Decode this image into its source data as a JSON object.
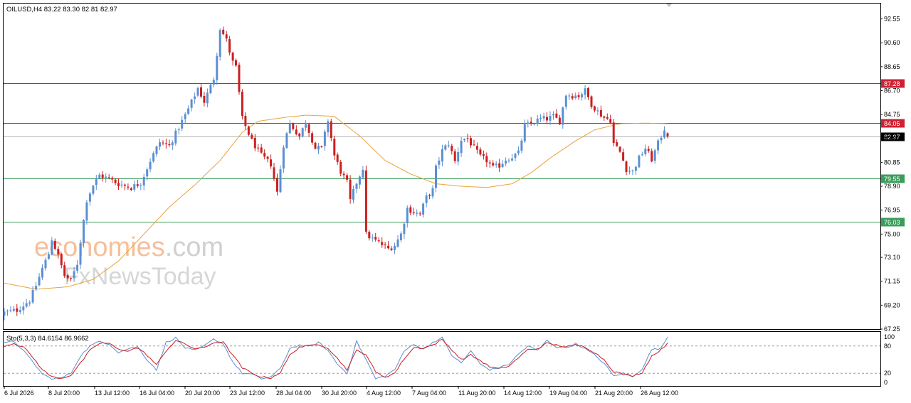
{
  "header": {
    "symbol_text": "OILUSD,H4  83.22 83.30 82.81 82.97"
  },
  "watermark": {
    "brand_colored": "economies",
    "brand_suffix": ".com",
    "sub_brand": "FxNewsToday",
    "brand_color": "#f5b48a",
    "suffix_color": "#c8c8c8",
    "sub_color": "#cfcfcf"
  },
  "colors": {
    "bull": "#5b8fd4",
    "bear": "#cc1f1f",
    "ma": "#e8a33c",
    "resistance": "#cc2233",
    "support": "#3a9e5a",
    "price_line": "#b5b5b5",
    "stoch_main": "#5b8fd4",
    "stoch_signal": "#cc1f1f"
  },
  "chart_data": [
    {
      "type": "candlestick",
      "symbol": "OILUSD",
      "timeframe": "H4",
      "ohlc_last": {
        "open": 83.22,
        "high": 83.3,
        "low": 82.81,
        "close": 82.97
      },
      "ylim": [
        67.25,
        93.8
      ],
      "y_ticks": [
        "92.55",
        "90.60",
        "88.65",
        "86.70",
        "84.75",
        "82.80",
        "80.85",
        "78.90",
        "76.95",
        "75.00",
        "73.10",
        "71.15",
        "69.20",
        "67.25"
      ],
      "x_ticks": [
        "6 Jul 2026",
        "8 Jul 20:00",
        "13 Jul 12:00",
        "16 Jul 04:00",
        "20 Jul 20:00",
        "23 Jul 12:00",
        "28 Jul 04:00",
        "30 Jul 20:00",
        "4 Aug 12:00",
        "7 Aug 04:00",
        "11 Aug 20:00",
        "14 Aug 12:00",
        "19 Aug 04:00",
        "21 Aug 20:00",
        "26 Aug 12:00"
      ],
      "levels": [
        {
          "value": 87.28,
          "label": "87.28",
          "kind": "resistance"
        },
        {
          "value": 84.05,
          "label": "84.05",
          "kind": "resistance"
        },
        {
          "value": 79.55,
          "label": "79.55",
          "kind": "support"
        },
        {
          "value": 76.03,
          "label": "76.03",
          "kind": "support"
        }
      ],
      "current_price": {
        "value": 82.97,
        "label": "82.97"
      },
      "close_path": [
        [
          0,
          68.6
        ],
        [
          4,
          68.8
        ],
        [
          8,
          69.6
        ],
        [
          10,
          70.8
        ],
        [
          12,
          72.2
        ],
        [
          14,
          73.4
        ],
        [
          15,
          74.6
        ],
        [
          17,
          73.2
        ],
        [
          19,
          71.6
        ],
        [
          21,
          71.2
        ],
        [
          23,
          72.6
        ],
        [
          24,
          74.4
        ],
        [
          26,
          77.8
        ],
        [
          28,
          79.0
        ],
        [
          30,
          79.8
        ],
        [
          33,
          79.5
        ],
        [
          36,
          79.1
        ],
        [
          40,
          78.8
        ],
        [
          43,
          79.2
        ],
        [
          46,
          81.0
        ],
        [
          49,
          82.5
        ],
        [
          52,
          82.2
        ],
        [
          55,
          83.7
        ],
        [
          58,
          85.2
        ],
        [
          61,
          86.9
        ],
        [
          63,
          85.8
        ],
        [
          66,
          87.7
        ],
        [
          68,
          91.8
        ],
        [
          70,
          90.8
        ],
        [
          72,
          89.0
        ],
        [
          73,
          88.6
        ],
        [
          75,
          84.4
        ],
        [
          78,
          82.6
        ],
        [
          81,
          81.4
        ],
        [
          84,
          80.7
        ],
        [
          86,
          78.4
        ],
        [
          88,
          82.3
        ],
        [
          90,
          84.0
        ],
        [
          93,
          83.0
        ],
        [
          95,
          84.1
        ],
        [
          98,
          82.0
        ],
        [
          100,
          82.0
        ],
        [
          102,
          84.3
        ],
        [
          104,
          81.4
        ],
        [
          106,
          80.1
        ],
        [
          108,
          79.2
        ],
        [
          109,
          77.7
        ],
        [
          111,
          79.2
        ],
        [
          113,
          80.4
        ],
        [
          114,
          75.0
        ],
        [
          116,
          74.6
        ],
        [
          118,
          74.3
        ],
        [
          121,
          73.8
        ],
        [
          123,
          74.1
        ],
        [
          125,
          75.0
        ],
        [
          127,
          77.1
        ],
        [
          129,
          76.8
        ],
        [
          131,
          76.6
        ],
        [
          133,
          78.0
        ],
        [
          135,
          78.6
        ],
        [
          136,
          80.4
        ],
        [
          138,
          81.8
        ],
        [
          140,
          82.4
        ],
        [
          142,
          80.9
        ],
        [
          144,
          82.7
        ],
        [
          146,
          82.8
        ],
        [
          148,
          82.0
        ],
        [
          150,
          81.3
        ],
        [
          152,
          81.0
        ],
        [
          154,
          80.4
        ],
        [
          156,
          80.6
        ],
        [
          158,
          81.1
        ],
        [
          160,
          81.3
        ],
        [
          162,
          81.6
        ],
        [
          164,
          83.8
        ],
        [
          166,
          84.0
        ],
        [
          169,
          84.4
        ],
        [
          171,
          84.4
        ],
        [
          173,
          84.6
        ],
        [
          175,
          84.2
        ],
        [
          177,
          86.4
        ],
        [
          179,
          86.3
        ],
        [
          181,
          86.3
        ],
        [
          183,
          86.7
        ],
        [
          185,
          85.6
        ],
        [
          187,
          85.0
        ],
        [
          189,
          84.5
        ],
        [
          191,
          84.3
        ],
        [
          192,
          82.4
        ],
        [
          194,
          81.7
        ],
        [
          196,
          80.3
        ],
        [
          198,
          80.1
        ],
        [
          200,
          81.2
        ],
        [
          202,
          82.0
        ],
        [
          204,
          81.1
        ],
        [
          206,
          82.4
        ],
        [
          208,
          83.6
        ],
        [
          209,
          82.97
        ]
      ],
      "moving_average_path": [
        [
          0,
          71.0
        ],
        [
          10,
          70.5
        ],
        [
          20,
          70.7
        ],
        [
          28,
          71.3
        ],
        [
          36,
          72.8
        ],
        [
          44,
          75.0
        ],
        [
          52,
          77.2
        ],
        [
          60,
          79.0
        ],
        [
          68,
          81.0
        ],
        [
          75,
          83.3
        ],
        [
          80,
          84.2
        ],
        [
          88,
          84.5
        ],
        [
          95,
          84.7
        ],
        [
          104,
          84.6
        ],
        [
          112,
          83.0
        ],
        [
          120,
          81.0
        ],
        [
          128,
          79.9
        ],
        [
          136,
          79.1
        ],
        [
          144,
          78.9
        ],
        [
          152,
          78.8
        ],
        [
          160,
          79.1
        ],
        [
          166,
          80.0
        ],
        [
          172,
          81.2
        ],
        [
          180,
          82.6
        ],
        [
          186,
          83.5
        ],
        [
          194,
          84.0
        ],
        [
          202,
          84.05
        ],
        [
          209,
          84.0
        ]
      ],
      "bar_count": 210
    },
    {
      "type": "line",
      "indicator": "Stochastic",
      "label": "Sto(5,3,3) 84.6154 86.9662",
      "ylim": [
        0,
        100
      ],
      "y_ticks": [
        "100",
        "80",
        "20",
        "0"
      ],
      "levels": [
        80,
        20
      ],
      "main_path": [
        [
          0,
          86
        ],
        [
          3,
          91
        ],
        [
          6,
          70
        ],
        [
          9,
          45
        ],
        [
          12,
          18
        ],
        [
          15,
          8
        ],
        [
          18,
          10
        ],
        [
          21,
          20
        ],
        [
          24,
          58
        ],
        [
          27,
          80
        ],
        [
          30,
          90
        ],
        [
          33,
          85
        ],
        [
          36,
          66
        ],
        [
          39,
          74
        ],
        [
          42,
          78
        ],
        [
          45,
          50
        ],
        [
          48,
          28
        ],
        [
          51,
          88
        ],
        [
          54,
          98
        ],
        [
          57,
          76
        ],
        [
          60,
          70
        ],
        [
          63,
          80
        ],
        [
          66,
          95
        ],
        [
          69,
          85
        ],
        [
          72,
          45
        ],
        [
          75,
          20
        ],
        [
          78,
          18
        ],
        [
          81,
          8
        ],
        [
          84,
          12
        ],
        [
          87,
          30
        ],
        [
          90,
          75
        ],
        [
          93,
          82
        ],
        [
          96,
          78
        ],
        [
          99,
          88
        ],
        [
          102,
          70
        ],
        [
          105,
          40
        ],
        [
          108,
          20
        ],
        [
          111,
          90
        ],
        [
          114,
          50
        ],
        [
          117,
          8
        ],
        [
          120,
          14
        ],
        [
          123,
          28
        ],
        [
          126,
          68
        ],
        [
          129,
          85
        ],
        [
          132,
          72
        ],
        [
          135,
          88
        ],
        [
          138,
          98
        ],
        [
          141,
          60
        ],
        [
          144,
          42
        ],
        [
          147,
          70
        ],
        [
          150,
          40
        ],
        [
          153,
          28
        ],
        [
          156,
          32
        ],
        [
          159,
          40
        ],
        [
          162,
          62
        ],
        [
          165,
          80
        ],
        [
          168,
          70
        ],
        [
          171,
          92
        ],
        [
          174,
          78
        ],
        [
          177,
          76
        ],
        [
          180,
          85
        ],
        [
          183,
          74
        ],
        [
          186,
          60
        ],
        [
          189,
          42
        ],
        [
          192,
          14
        ],
        [
          195,
          20
        ],
        [
          198,
          12
        ],
        [
          201,
          30
        ],
        [
          204,
          72
        ],
        [
          207,
          75
        ],
        [
          209,
          100
        ]
      ],
      "signal_path": [
        [
          0,
          80
        ],
        [
          3,
          86
        ],
        [
          6,
          78
        ],
        [
          9,
          55
        ],
        [
          12,
          28
        ],
        [
          15,
          12
        ],
        [
          18,
          9
        ],
        [
          21,
          16
        ],
        [
          24,
          42
        ],
        [
          27,
          70
        ],
        [
          30,
          86
        ],
        [
          33,
          86
        ],
        [
          36,
          72
        ],
        [
          39,
          70
        ],
        [
          42,
          76
        ],
        [
          45,
          60
        ],
        [
          48,
          38
        ],
        [
          51,
          70
        ],
        [
          54,
          92
        ],
        [
          57,
          84
        ],
        [
          60,
          74
        ],
        [
          63,
          76
        ],
        [
          66,
          88
        ],
        [
          69,
          88
        ],
        [
          72,
          60
        ],
        [
          75,
          32
        ],
        [
          78,
          20
        ],
        [
          81,
          12
        ],
        [
          84,
          10
        ],
        [
          87,
          22
        ],
        [
          90,
          60
        ],
        [
          93,
          78
        ],
        [
          96,
          80
        ],
        [
          99,
          84
        ],
        [
          102,
          76
        ],
        [
          105,
          52
        ],
        [
          108,
          28
        ],
        [
          111,
          70
        ],
        [
          114,
          62
        ],
        [
          117,
          22
        ],
        [
          120,
          12
        ],
        [
          123,
          20
        ],
        [
          126,
          52
        ],
        [
          129,
          76
        ],
        [
          132,
          76
        ],
        [
          135,
          82
        ],
        [
          138,
          94
        ],
        [
          141,
          72
        ],
        [
          144,
          50
        ],
        [
          147,
          60
        ],
        [
          150,
          48
        ],
        [
          153,
          34
        ],
        [
          156,
          30
        ],
        [
          159,
          36
        ],
        [
          162,
          54
        ],
        [
          165,
          72
        ],
        [
          168,
          74
        ],
        [
          171,
          86
        ],
        [
          174,
          82
        ],
        [
          177,
          78
        ],
        [
          180,
          82
        ],
        [
          183,
          78
        ],
        [
          186,
          66
        ],
        [
          189,
          50
        ],
        [
          192,
          24
        ],
        [
          195,
          18
        ],
        [
          198,
          14
        ],
        [
          201,
          22
        ],
        [
          204,
          58
        ],
        [
          207,
          72
        ],
        [
          209,
          87
        ]
      ]
    }
  ]
}
